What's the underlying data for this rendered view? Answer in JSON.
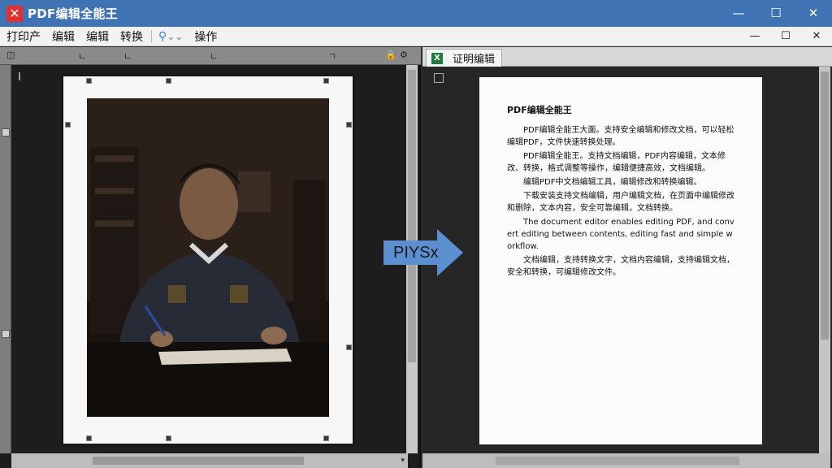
{
  "app": {
    "title": "PDF编辑全能王",
    "icon": "close-x-icon"
  },
  "window_controls": {
    "minimize": "—",
    "maximize": "☐",
    "close": "✕"
  },
  "menu": {
    "items": [
      "打印产",
      "编辑",
      "编辑",
      "转换"
    ],
    "action": "操作"
  },
  "sub_window_controls": {
    "minimize": "—",
    "maximize": "☐",
    "close": "✕"
  },
  "left_panel": {
    "cursor_glyph": "I"
  },
  "arrow": {
    "label": "PIYSx",
    "color": "#5b8fd0"
  },
  "right_panel": {
    "tab_label": "证明编辑",
    "document": {
      "title": "PDF编辑全能王",
      "paragraphs": [
        "PDF编辑全能王大面。支持安全编辑和修改文档，可以轻松编辑PDF，文件快速转换处理。",
        "PDF编辑全能王。支持文档编辑，PDF内容编辑，文本修改、转换，格式调整等操作，编辑便捷高效，文档编辑。",
        "编辑PDF中文档编辑工具，编辑修改和转换编辑。",
        "下载安装支持文档编辑，用户编辑文档，在页面中编辑修改和删除，文本内容，安全可靠编辑，文档转换。",
        "The document editor enables editing PDF, and convert editing between contents, editing fast and simple workflow.",
        "文档编辑，支持转换文字，文档内容编辑，支持编辑文档，安全和转换，可编辑修改文件。"
      ]
    }
  },
  "colors": {
    "titlebar": "#3f73b4",
    "app_icon": "#e23030",
    "arrow": "#5b8fd0"
  }
}
